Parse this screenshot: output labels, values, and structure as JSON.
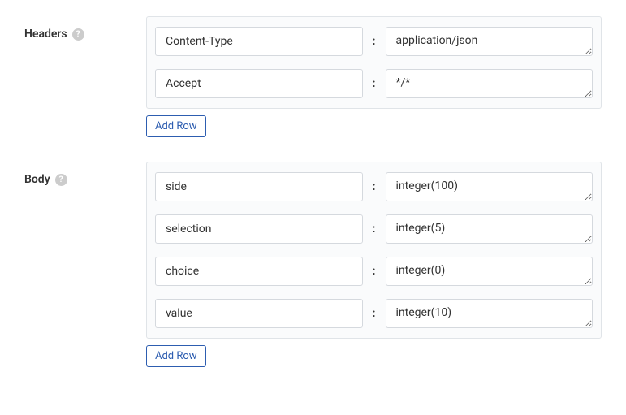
{
  "headers": {
    "label": "Headers",
    "rows": [
      {
        "key": "Content-Type",
        "value": "application/json"
      },
      {
        "key": "Accept",
        "value": "*/*"
      }
    ],
    "add_row_label": "Add Row"
  },
  "body": {
    "label": "Body",
    "rows": [
      {
        "key": "side",
        "value": "integer(100)"
      },
      {
        "key": "selection",
        "value": "integer(5)"
      },
      {
        "key": "choice",
        "value": "integer(0)"
      },
      {
        "key": "value",
        "value": "integer(10)"
      }
    ],
    "add_row_label": "Add Row"
  },
  "separator": ":"
}
